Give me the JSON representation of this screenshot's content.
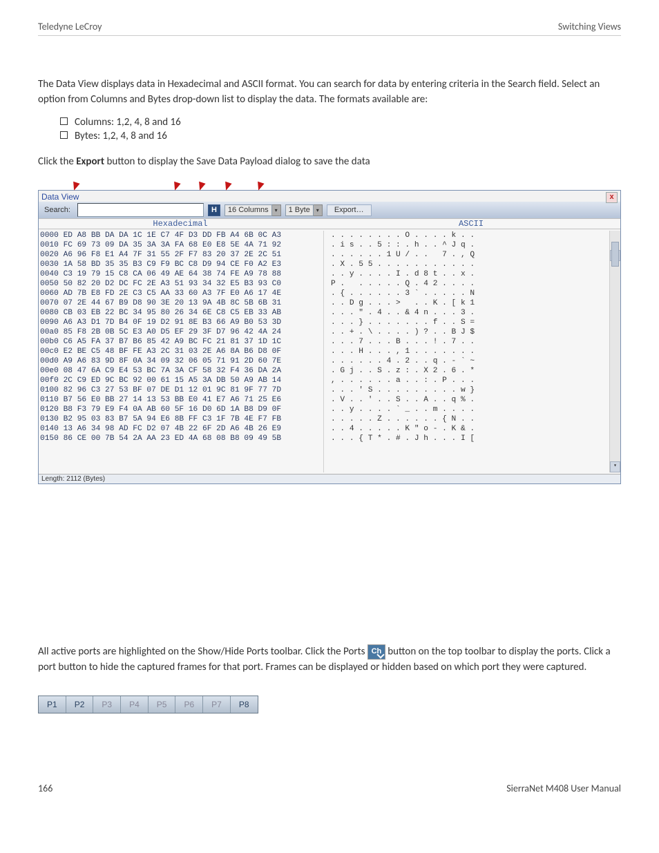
{
  "header": {
    "left": "Teledyne LeCroy",
    "right": "Switching Views"
  },
  "intro": "The Data View displays data in Hexadecimal and ASCII format. You can search for data by entering criteria in the Search field. Select an option from Columns and Bytes drop-down list to display the data. The formats available are:",
  "bullets": [
    "Columns: 1,2, 4, 8 and 16",
    "Bytes: 1,2, 4, 8 and 16"
  ],
  "export_line_pre": "Click the ",
  "export_bold": "Export",
  "export_line_post": " button to display the Save Data Payload dialog to save the data",
  "dv": {
    "title": "Data View",
    "search_label": "Search:",
    "search_value": "",
    "icon": "H",
    "columns_sel": "16 Columns",
    "bytes_sel": "1 Byte",
    "export_btn": "Export…",
    "hdr_hex": "Hexadecimal",
    "hdr_asc": "ASCII",
    "status": "Length: 2112 (Bytes)"
  },
  "hex": {
    "rows": [
      {
        "ofs": "0000",
        "hx": "ED A8 BB DA DA 1C 1E C7 4F D3 DD FB A4 6B 0C A3",
        "as": ". . . . . . . . O . . . . k . ."
      },
      {
        "ofs": "0010",
        "hx": "FC 69 73 09 DA 35 3A 3A FA 68 E0 E8 5E 4A 71 92",
        "as": ". i s . . 5 : : . h . . ^ J q ."
      },
      {
        "ofs": "0020",
        "hx": "A6 96 F8 E1 A4 7F 31 55 2F F7 83 20 37 2E 2C 51",
        "as": ". . . . . . 1 U / . .   7 . , Q"
      },
      {
        "ofs": "0030",
        "hx": "1A 58 BD 35 35 B3 C9 F9 BC C8 D9 94 CE F0 A2 E3",
        "as": ". X . 5 5 . . . . . . . . . . ."
      },
      {
        "ofs": "0040",
        "hx": "C3 19 79 15 C8 CA 06 49 AE 64 38 74 FE A9 78 88",
        "as": ". . y . . . . I . d 8 t . . x ."
      },
      {
        "ofs": "0050",
        "hx": "50 82 20 D2 DC FC 2E A3 51 93 34 32 E5 B3 93 C0",
        "as": "P .   . . . . . Q . 4 2 . . . ."
      },
      {
        "ofs": "0060",
        "hx": "AD 7B E8 FD 2E C3 C5 AA 33 60 A3 7F E0 A6 17 4E",
        "as": ". { . . . . . . 3 ` . . . . . N"
      },
      {
        "ofs": "0070",
        "hx": "07 2E 44 67 B9 D8 90 3E 20 13 9A 4B 8C 5B 6B 31",
        "as": ". . D g . . . >   . . K . [ k 1"
      },
      {
        "ofs": "0080",
        "hx": "CB 03 EB 22 BC 34 95 80 26 34 6E C8 C5 EB 33 AB",
        "as": ". . . \" . 4 . . & 4 n . . . 3 ."
      },
      {
        "ofs": "0090",
        "hx": "A6 A3 D1 7D B4 0F 19 D2 91 8E B3 66 A9 B0 53 3D",
        "as": ". . . } . . . . . . . f . . S ="
      },
      {
        "ofs": "00a0",
        "hx": "85 F8 2B 0B 5C E3 A0 D5 EF 29 3F D7 96 42 4A 24",
        "as": ". . + . \\ . . . . ) ? . . B J $"
      },
      {
        "ofs": "00b0",
        "hx": "C6 A5 FA 37 B7 B6 85 42 A9 BC FC 21 81 37 1D 1C",
        "as": ". . . 7 . . . B . . . ! . 7 . ."
      },
      {
        "ofs": "00c0",
        "hx": "E2 BE C5 48 BF FE A3 2C 31 03 2E A6 8A B6 D8 0F",
        "as": ". . . H . . . , 1 . . . . . . ."
      },
      {
        "ofs": "00d0",
        "hx": "A9 A6 83 9D 8F 0A 34 09 32 06 05 71 91 2D 60 7E",
        "as": ". . . . . . 4 . 2 . . q . - ` ~"
      },
      {
        "ofs": "00e0",
        "hx": "08 47 6A C9 E4 53 BC 7A 3A CF 58 32 F4 36 DA 2A",
        "as": ". G j . . S . z : . X 2 . 6 . *"
      },
      {
        "ofs": "00f0",
        "hx": "2C C9 ED 9C BC 92 00 61 15 A5 3A DB 50 A9 AB 14",
        "as": ", . . . . . . a . . : . P . . ."
      },
      {
        "ofs": "0100",
        "hx": "82 96 C3 27 53 BF 07 DE D1 12 01 9C 81 9F 77 7D",
        "as": ". . . ' S . . . . . . . . . w }"
      },
      {
        "ofs": "0110",
        "hx": "B7 56 E0 BB 27 14 13 53 BB E0 41 E7 A6 71 25 E6",
        "as": ". V . . ' . . S . . A . . q % ."
      },
      {
        "ofs": "0120",
        "hx": "B8 F3 79 E9 F4 0A AB 60 5F 16 D0 6D 1A B8 D9 0F",
        "as": ". . y . . . . ` _ . . m . . . ."
      },
      {
        "ofs": "0130",
        "hx": "B2 95 03 83 B7 5A 94 E6 8B FF C3 1F 7B 4E F7 FB",
        "as": ". . . . . Z . . . . . . { N . ."
      },
      {
        "ofs": "0140",
        "hx": "13 A6 34 98 AD FC D2 07 4B 22 6F 2D A6 4B 26 E9",
        "as": ". . 4 . . . . . K \" o - . K & ."
      },
      {
        "ofs": "0150",
        "hx": "86 CE 00 7B 54 2A AA 23 ED 4A 68 08 B8 09 49 5B",
        "as": ". . . { T * . # . J h . . . I ["
      }
    ]
  },
  "ports_text_pre": "All active ports are highlighted on the Show/Hide Ports toolbar. Click the Ports ",
  "ports_text_post": " button on the top toolbar to display the ports. Click a port button to hide the captured frames for that port. Frames can be displayed or hidden based on which port they were captured.",
  "inline_icon": "Ch",
  "ports": [
    "P1",
    "P2",
    "P3",
    "P4",
    "P5",
    "P6",
    "P7",
    "P8"
  ],
  "footer": {
    "page": "166",
    "doc": "SierraNet M408 User Manual"
  }
}
